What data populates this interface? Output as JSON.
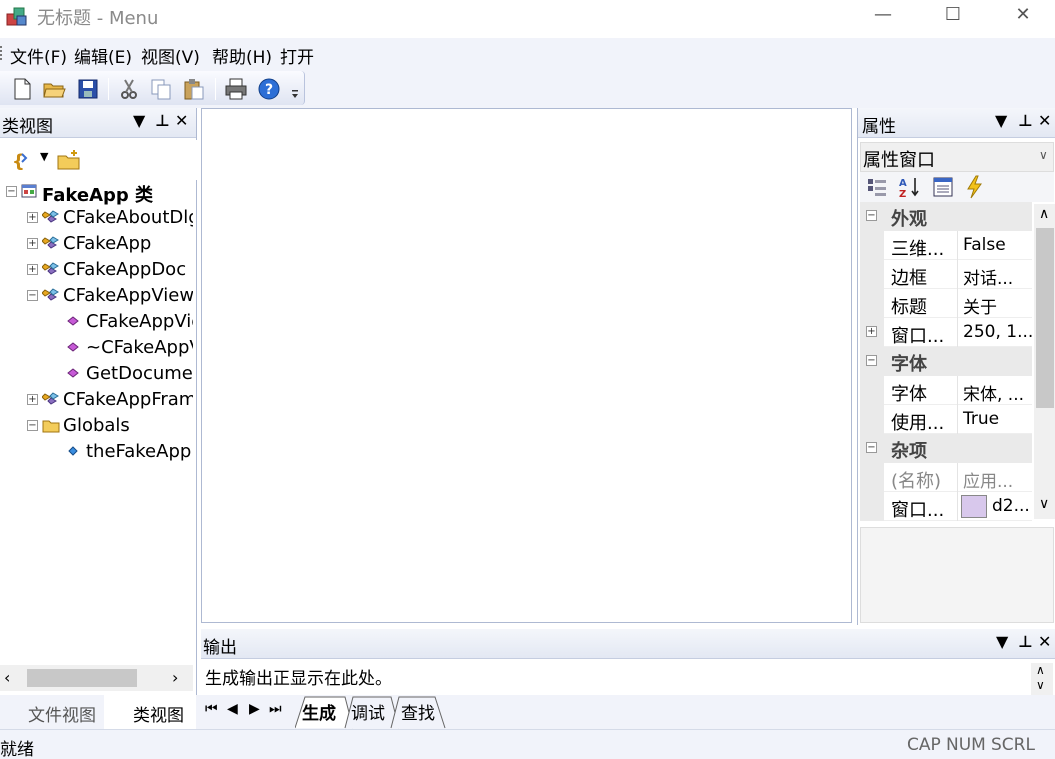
{
  "window": {
    "title": "无标题 - Menu",
    "minimize": "—",
    "maximize": "☐",
    "close": "✕"
  },
  "menu": [
    "文件(F)",
    "编辑(E)",
    "视图(V)",
    "帮助(H)",
    "打开"
  ],
  "classview": {
    "title": "类视图",
    "tree": [
      {
        "label": "FakeApp 类",
        "level": 0,
        "expander": "−",
        "icon": "class-root-icon",
        "bold": true
      },
      {
        "label": "CFakeAboutDlg",
        "level": 1,
        "expander": "+",
        "icon": "class-icon"
      },
      {
        "label": "CFakeApp",
        "level": 1,
        "expander": "+",
        "icon": "class-icon"
      },
      {
        "label": "CFakeAppDoc",
        "level": 1,
        "expander": "+",
        "icon": "class-icon"
      },
      {
        "label": "CFakeAppView",
        "level": 1,
        "expander": "−",
        "icon": "class-icon"
      },
      {
        "label": "CFakeAppView",
        "level": 2,
        "expander": "",
        "icon": "method-icon"
      },
      {
        "label": "~CFakeAppView",
        "level": 2,
        "expander": "",
        "icon": "method-icon"
      },
      {
        "label": "GetDocument",
        "level": 2,
        "expander": "",
        "icon": "method-icon"
      },
      {
        "label": "CFakeAppFrame",
        "level": 1,
        "expander": "+",
        "icon": "class-icon"
      },
      {
        "label": "Globals",
        "level": 1,
        "expander": "−",
        "icon": "folder-icon"
      },
      {
        "label": "theFakeApp",
        "level": 2,
        "expander": "",
        "icon": "variable-icon"
      }
    ],
    "tabs": [
      "文件视图",
      "类视图"
    ]
  },
  "properties": {
    "title": "属性",
    "combo": "属性窗口",
    "rows": [
      {
        "type": "cat",
        "name": "外观",
        "expander": "−"
      },
      {
        "type": "prop",
        "name": "三维...",
        "value": "False"
      },
      {
        "type": "prop",
        "name": "边框",
        "value": "对话..."
      },
      {
        "type": "prop",
        "name": "标题",
        "value": "关于"
      },
      {
        "type": "prop",
        "name": "窗口...",
        "value": "250, 1...",
        "expander": "+"
      },
      {
        "type": "cat",
        "name": "字体",
        "expander": "−"
      },
      {
        "type": "prop",
        "name": "字体",
        "value": "宋体, ..."
      },
      {
        "type": "prop",
        "name": "使用...",
        "value": "True"
      },
      {
        "type": "cat",
        "name": "杂项",
        "expander": "−"
      },
      {
        "type": "prop",
        "name": "(名称)",
        "value": "应用...",
        "grey": true
      },
      {
        "type": "prop",
        "name": "窗口...",
        "value": "d2...",
        "swatch": "#d8c8ec"
      }
    ]
  },
  "output": {
    "title": "输出",
    "lines": [
      "生成输出正显示在此处。"
    ],
    "tabs": [
      "生成",
      "调试",
      "查找"
    ]
  },
  "status": {
    "text": "就绪",
    "indicators": [
      "CAP",
      "NUM",
      "SCRL"
    ]
  },
  "colors": {
    "chrome": "#f1f3fa",
    "border": "#aeb9d2",
    "accent_toolbar": "#dfe4f2"
  }
}
